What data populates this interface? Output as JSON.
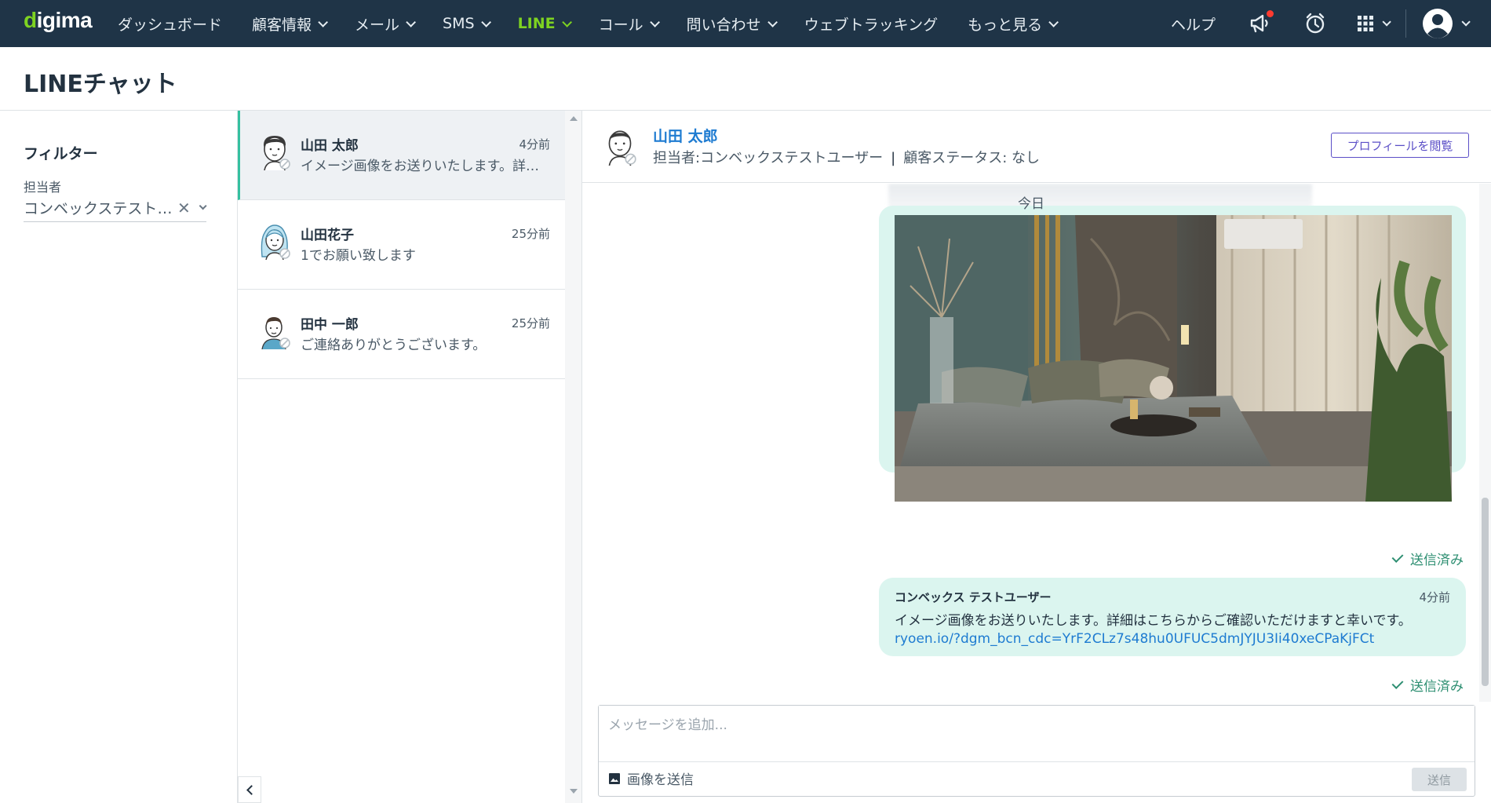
{
  "nav": {
    "logo": "digima",
    "items": [
      {
        "label": "ダッシュボード",
        "has_menu": false,
        "active": false
      },
      {
        "label": "顧客情報",
        "has_menu": true,
        "active": false
      },
      {
        "label": "メール",
        "has_menu": true,
        "active": false
      },
      {
        "label": "SMS",
        "has_menu": true,
        "active": false
      },
      {
        "label": "LINE",
        "has_menu": true,
        "active": true
      },
      {
        "label": "コール",
        "has_menu": true,
        "active": false
      },
      {
        "label": "問い合わせ",
        "has_menu": true,
        "active": false
      },
      {
        "label": "ウェブトラッキング",
        "has_menu": false,
        "active": false
      },
      {
        "label": "もっと見る",
        "has_menu": true,
        "active": false
      }
    ],
    "help": "ヘルプ",
    "icons": [
      "announcement-icon",
      "alarm-clock-icon",
      "apps-grid-icon",
      "user-avatar-icon"
    ]
  },
  "page": {
    "title": "LINEチャット"
  },
  "filter": {
    "title": "フィルター",
    "assignee_label": "担当者",
    "assignee_value": "コンベックステストユーザー"
  },
  "conversations": [
    {
      "name": "山田 太郎",
      "time": "4分前",
      "preview": "イメージ画像をお送りいたします。詳細はこちらからご確認いただけますと幸いです。",
      "selected": true,
      "avatar": "man-avatar"
    },
    {
      "name": "山田花子",
      "time": "25分前",
      "preview": "1でお願い致します",
      "selected": false,
      "avatar": "woman-avatar"
    },
    {
      "name": "田中 一郎",
      "time": "25分前",
      "preview": "ご連絡ありがとうございます。",
      "selected": false,
      "avatar": "man-avatar-2"
    }
  ],
  "chat": {
    "contact_name": "山田 太郎",
    "assignee_text": "担当者:コンベックステストユーザー",
    "status_text": "顧客ステータス: なし",
    "separator": "|",
    "profile_button": "プロフィールを閲覧",
    "date_separator": "今日",
    "messages": [
      {
        "type": "image",
        "status": "送信済み"
      },
      {
        "type": "text",
        "sender": "コンベックス テストユーザー",
        "time": "4分前",
        "body": "イメージ画像をお送りいたします。詳細はこちらからご確認いただけますと幸いです。",
        "link": "ryoen.io/?dgm_bcn_cdc=YrF2CLz7s48hu0UFUC5dmJYJU3Ii40xeCPaKjFCt",
        "status": "送信済み"
      }
    ],
    "composer_placeholder": "メッセージを追加...",
    "send_image_label": "画像を送信",
    "send_button": "送信"
  },
  "colors": {
    "nav_bg": "#1f3447",
    "accent_green": "#7ed321",
    "bubble_bg": "#dbf5ef",
    "selected_border": "#35c0a0",
    "link_blue": "#1e7bd1",
    "profile_btn": "#5b4fc7"
  }
}
